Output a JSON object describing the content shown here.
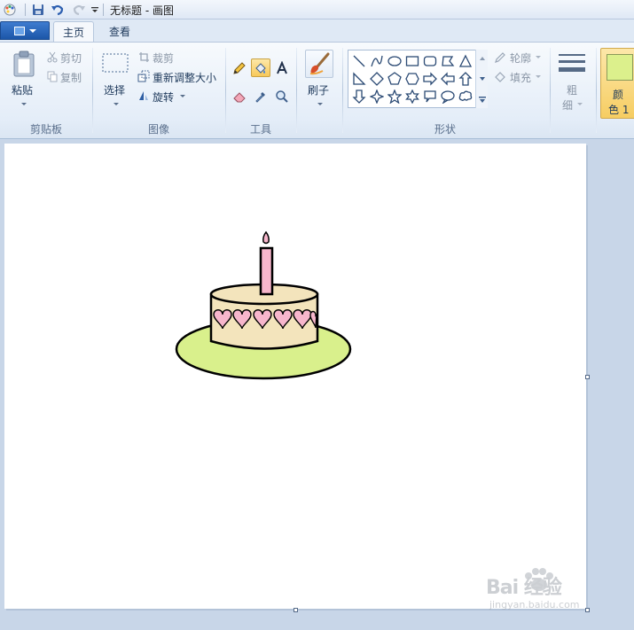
{
  "window": {
    "title": "无标题 - 画图"
  },
  "tabs": {
    "home": "主页",
    "view": "查看"
  },
  "clipboard": {
    "paste": "粘贴",
    "cut": "剪切",
    "copy": "复制",
    "group_label": "剪贴板"
  },
  "image": {
    "select": "选择",
    "crop": "裁剪",
    "resize": "重新调整大小",
    "rotate": "旋转",
    "group_label": "图像"
  },
  "tools": {
    "group_label": "工具"
  },
  "brushes": {
    "label": "刷子"
  },
  "shapes": {
    "outline": "轮廓",
    "fill": "填充",
    "group_label": "形状"
  },
  "size": {
    "label_line1": "粗",
    "label_line2": "细"
  },
  "color1": {
    "label_line1": "颜",
    "label_line2": "色 1",
    "color": "#dcf08c"
  },
  "drawing": {
    "plate_color": "#d9f08c",
    "cake_color": "#f3e4bc",
    "candle_color": "#f7b6cc",
    "heart_color": "#f7b6cc"
  },
  "watermark": {
    "main": "Bai 经验",
    "sub": "jingyan.baidu.com"
  }
}
